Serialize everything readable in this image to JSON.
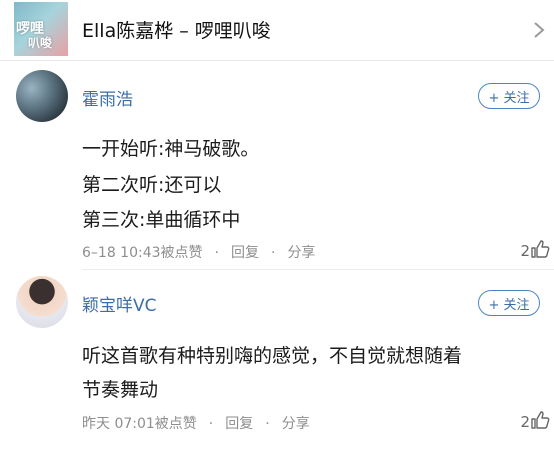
{
  "song": {
    "title": "Ella陈嘉桦 – 啰哩叭唆",
    "cover_text_line1": "啰哩",
    "cover_text_line2": "叭唆"
  },
  "comments": [
    {
      "username": "霍雨浩",
      "follow_label": "+ 关注",
      "body_lines": [
        "一开始听:神马破歌。",
        "第二次听:还可以",
        "第三次:单曲循环中"
      ],
      "time": "6–18 10:43",
      "like_action": "被点赞",
      "reply_label": "回复",
      "share_label": "分享",
      "like_count": "2"
    },
    {
      "username": "颖宝咩VC",
      "follow_label": "+ 关注",
      "body_lines": [
        "听这首歌有种特别嗨的感觉，不自觉就想随着",
        "节奏舞动"
      ],
      "time": "昨天 07:01",
      "like_action": "被点赞",
      "reply_label": "回复",
      "share_label": "分享",
      "like_count": "2"
    }
  ],
  "separator_dot": "·",
  "icons": {
    "chevron": "chevron-right-icon",
    "thumb": "thumb-up-icon"
  },
  "colors": {
    "accent": "#3b6ea8",
    "follow_border": "#4a86c5",
    "meta_text": "#8e8e8e"
  }
}
